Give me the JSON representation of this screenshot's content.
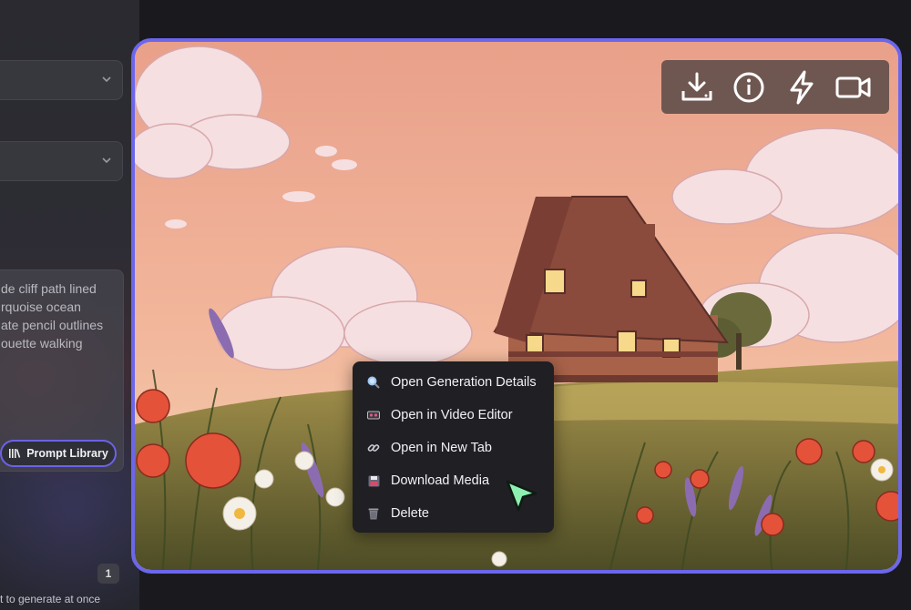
{
  "left_panel": {
    "prompt_text": "de cliff path lined\nrquoise ocean\nate pencil outlines\nouette walking",
    "prompt_library_label": "Prompt Library",
    "generate_count": "1",
    "generate_note": "t to generate at once"
  },
  "toolbar": {
    "icons": [
      "download-icon",
      "info-icon",
      "lightning-icon",
      "video-camera-icon"
    ]
  },
  "context_menu": {
    "items": [
      {
        "label": "Open Generation Details",
        "icon": "magnifier-icon"
      },
      {
        "label": "Open in Video Editor",
        "icon": "video-tape-icon"
      },
      {
        "label": "Open in New Tab",
        "icon": "link-icon"
      },
      {
        "label": "Download Media",
        "icon": "floppy-disk-icon"
      },
      {
        "label": "Delete",
        "icon": "trash-icon"
      }
    ]
  },
  "colors": {
    "accent": "#6c66ec",
    "panel_bg": "#1a1a1e",
    "menu_bg": "#1f1f24",
    "cursor": "#8df0b0"
  }
}
